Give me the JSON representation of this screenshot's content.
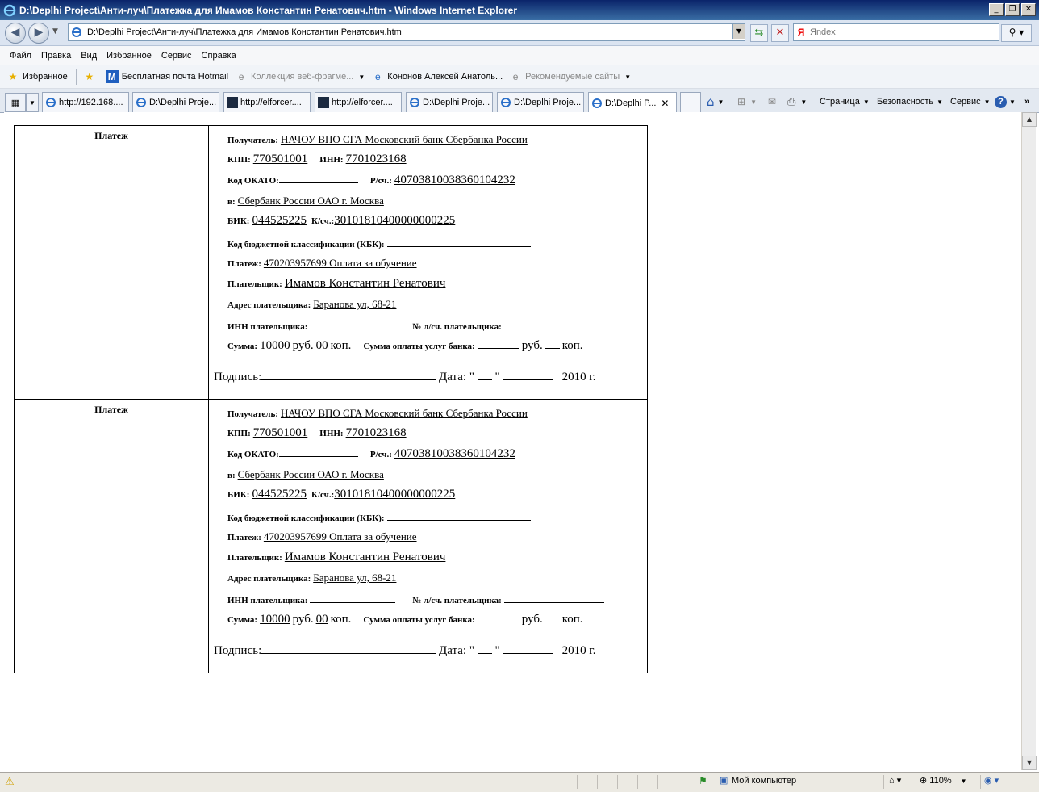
{
  "window": {
    "title": "D:\\Deplhi Project\\Анти-луч\\Платежка для Имамов Константин Ренатович.htm - Windows Internet Explorer"
  },
  "address": {
    "url": "D:\\Deplhi Project\\Анти-луч\\Платежка для Имамов Константин Ренатович.htm",
    "search_placeholder": "Яndex"
  },
  "menu": [
    "Файл",
    "Правка",
    "Вид",
    "Избранное",
    "Сервис",
    "Справка"
  ],
  "favorites": {
    "label": "Избранное",
    "items": [
      "Бесплатная почта Hotmail",
      "Коллекция веб-фрагме...",
      "Кононов Алексей Анатоль...",
      "Рекомендуемые сайты"
    ]
  },
  "tabs": [
    "http://192.168....",
    "D:\\Deplhi Proje...",
    "http://elforcer....",
    "http://elforcer....",
    "D:\\Deplhi Proje...",
    "D:\\Deplhi Proje...",
    "D:\\Deplhi P..."
  ],
  "toolbar": {
    "page": "Страница",
    "security": "Безопасность",
    "service": "Сервис"
  },
  "payment": {
    "left_label": "Платеж",
    "recipient_label": "Получатель:",
    "recipient": "НАЧОУ ВПО СГА Московский банк Сбербанка России",
    "kpp_label": "КПП:",
    "kpp": "770501001",
    "inn_label": "ИНН:",
    "inn": "7701023168",
    "okato_label": "Код ОКАТО:",
    "account_label": "Р/сч.:",
    "account": "40703810038360104232",
    "bank_prefix": "в:",
    "bank": "Сбербанк России ОАО г. Москва",
    "bik_label": "БИК:",
    "bik": "044525225",
    "corr_label": "К/сч.:",
    "corr": "30101810400000000225",
    "kbk_label": "Код бюджетной классификации (КБК):",
    "purpose_label": "Платеж:",
    "purpose": "470203957699 Оплата за обучение",
    "payer_label": "Плательщик:",
    "payer": "Имамов Константин Ренатович",
    "address_label": "Адрес плательщика:",
    "address": "Баранова ул, 68-21",
    "payer_inn_label": "ИНН плательщика:",
    "payer_account_label": "№ л/сч. плательщика:",
    "sum_label": "Сумма:",
    "sum_rub": "10000",
    "rub": "руб.",
    "sum_kop": "00",
    "kop": "коп.",
    "bank_fee_label": "Сумма оплаты услуг банка:",
    "signature_label": "Подпись:",
    "date_label": "Дата: \"",
    "date_quote": "\"",
    "year": "2010 г."
  },
  "status": {
    "zone": "Мой компьютер",
    "zoom": "110%"
  }
}
